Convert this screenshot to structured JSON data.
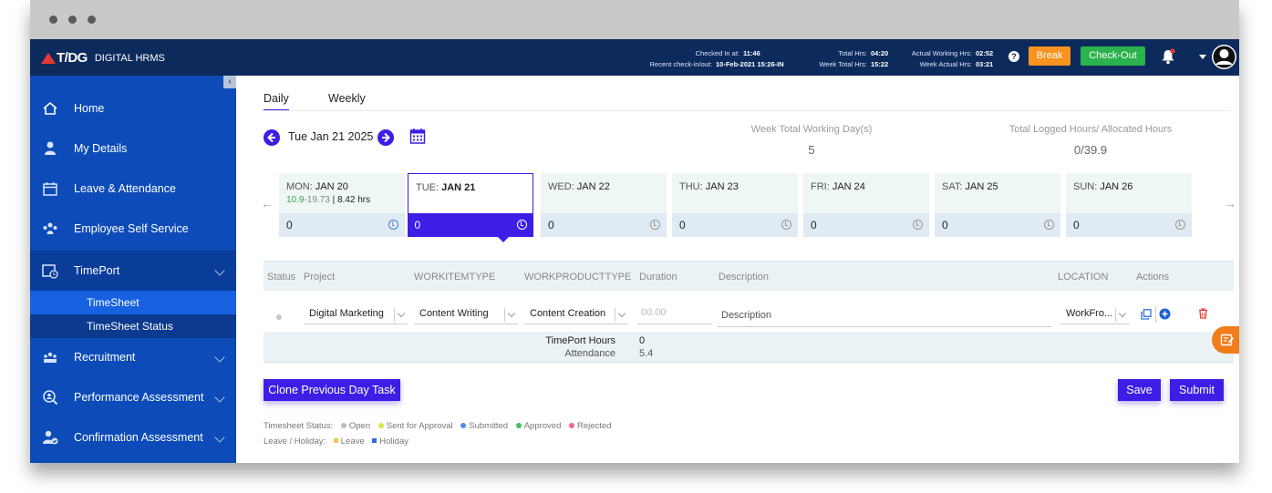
{
  "header": {
    "logo_mark": "T/DG",
    "logo_name": "DIGITAL HRMS",
    "checked_in_label": "Checked In at:",
    "checked_in_value": "11:46",
    "recent_label": "Recent check-in/out:",
    "recent_value": "10-Feb-2021 15:26-IN",
    "total_hrs_label": "Total Hrs:",
    "total_hrs_value": "04:20",
    "week_total_label": "Week Total Hrs:",
    "week_total_value": "15:22",
    "actual_working_label": "Actual Working Hrs:",
    "actual_working_value": "02:52",
    "week_actual_label": "Week Actual Hrs:",
    "week_actual_value": "03:21",
    "help_glyph": "?",
    "break_label": "Break",
    "checkout_label": "Check-Out",
    "colors": {
      "bar": "#0d2a5c",
      "break": "#f7931e",
      "checkout": "#2bb24c"
    }
  },
  "sidebar": {
    "collapse_glyph": "‹",
    "items": [
      {
        "label": "Home",
        "icon": "home-icon"
      },
      {
        "label": "My Details",
        "icon": "user-icon"
      },
      {
        "label": "Leave & Attendance",
        "icon": "calendar-icon"
      },
      {
        "label": "Employee Self Service",
        "icon": "group-icon"
      },
      {
        "label": "TimePort",
        "icon": "timeport-icon"
      },
      {
        "label": "Recruitment",
        "icon": "recruitment-icon"
      },
      {
        "label": "Performance Assessment",
        "icon": "search-user-icon"
      },
      {
        "label": "Confirmation Assessment",
        "icon": "user-check-icon"
      }
    ],
    "subitems": [
      {
        "label": "TimeSheet"
      },
      {
        "label": "TimeSheet Status"
      }
    ]
  },
  "main": {
    "tabs": [
      {
        "label": "Daily"
      },
      {
        "label": "Weekly"
      }
    ],
    "current_date": "Tue Jan 21 2025",
    "week_days_label": "Week Total Working Day(s)",
    "week_days_value": "5",
    "logged_label": "Total Logged Hours/ Allocated Hours",
    "logged_value": "0/39.9",
    "days": [
      {
        "dow": "MON:",
        "date": "JAN 20",
        "hours": "0",
        "green": "10.9",
        "grey": "-19.73",
        "extra": " | 8.42 hrs"
      },
      {
        "dow": "TUE:",
        "date": "JAN 21",
        "hours": "0"
      },
      {
        "dow": "WED:",
        "date": "JAN 22",
        "hours": "0"
      },
      {
        "dow": "THU:",
        "date": "JAN 23",
        "hours": "0"
      },
      {
        "dow": "FRI:",
        "date": "JAN 24",
        "hours": "0"
      },
      {
        "dow": "SAT:",
        "date": "JAN 25",
        "hours": "0"
      },
      {
        "dow": "SUN:",
        "date": "JAN 26",
        "hours": "0"
      }
    ],
    "columns": [
      "Status",
      "Project",
      "WORKITEMTYPE",
      "WORKPRODUCTTYPE",
      "Duration",
      "Description",
      "LOCATION",
      "Actions"
    ],
    "row": {
      "project": "Digital Marketing",
      "workitem": "Content Writing",
      "workproduct": "Content Creation",
      "duration_placeholder": "00.00",
      "description_placeholder": "Description",
      "location": "WorkFro..."
    },
    "totals": {
      "timeport_label": "TimePort Hours",
      "timeport_value": "0",
      "attendance_label": "Attendance",
      "attendance_value": "5.4"
    },
    "clone_label": "Clone Previous Day Task",
    "save_label": "Save",
    "submit_label": "Submit",
    "legend": {
      "status_title": "Timesheet Status:",
      "status": [
        {
          "label": "Open",
          "color": "#bdbdbd"
        },
        {
          "label": "Sent for Approval",
          "color": "#d7e84a"
        },
        {
          "label": "Submitted",
          "color": "#4a8ef0"
        },
        {
          "label": "Approved",
          "color": "#3ec35a"
        },
        {
          "label": "Rejected",
          "color": "#f06a8a"
        }
      ],
      "leave_title": "Leave / Holiday:",
      "leave": [
        {
          "label": "Leave",
          "color": "#f2c94c"
        },
        {
          "label": "Holiday",
          "color": "#2f6fe0"
        }
      ]
    },
    "accent": "#3d1ee6"
  }
}
